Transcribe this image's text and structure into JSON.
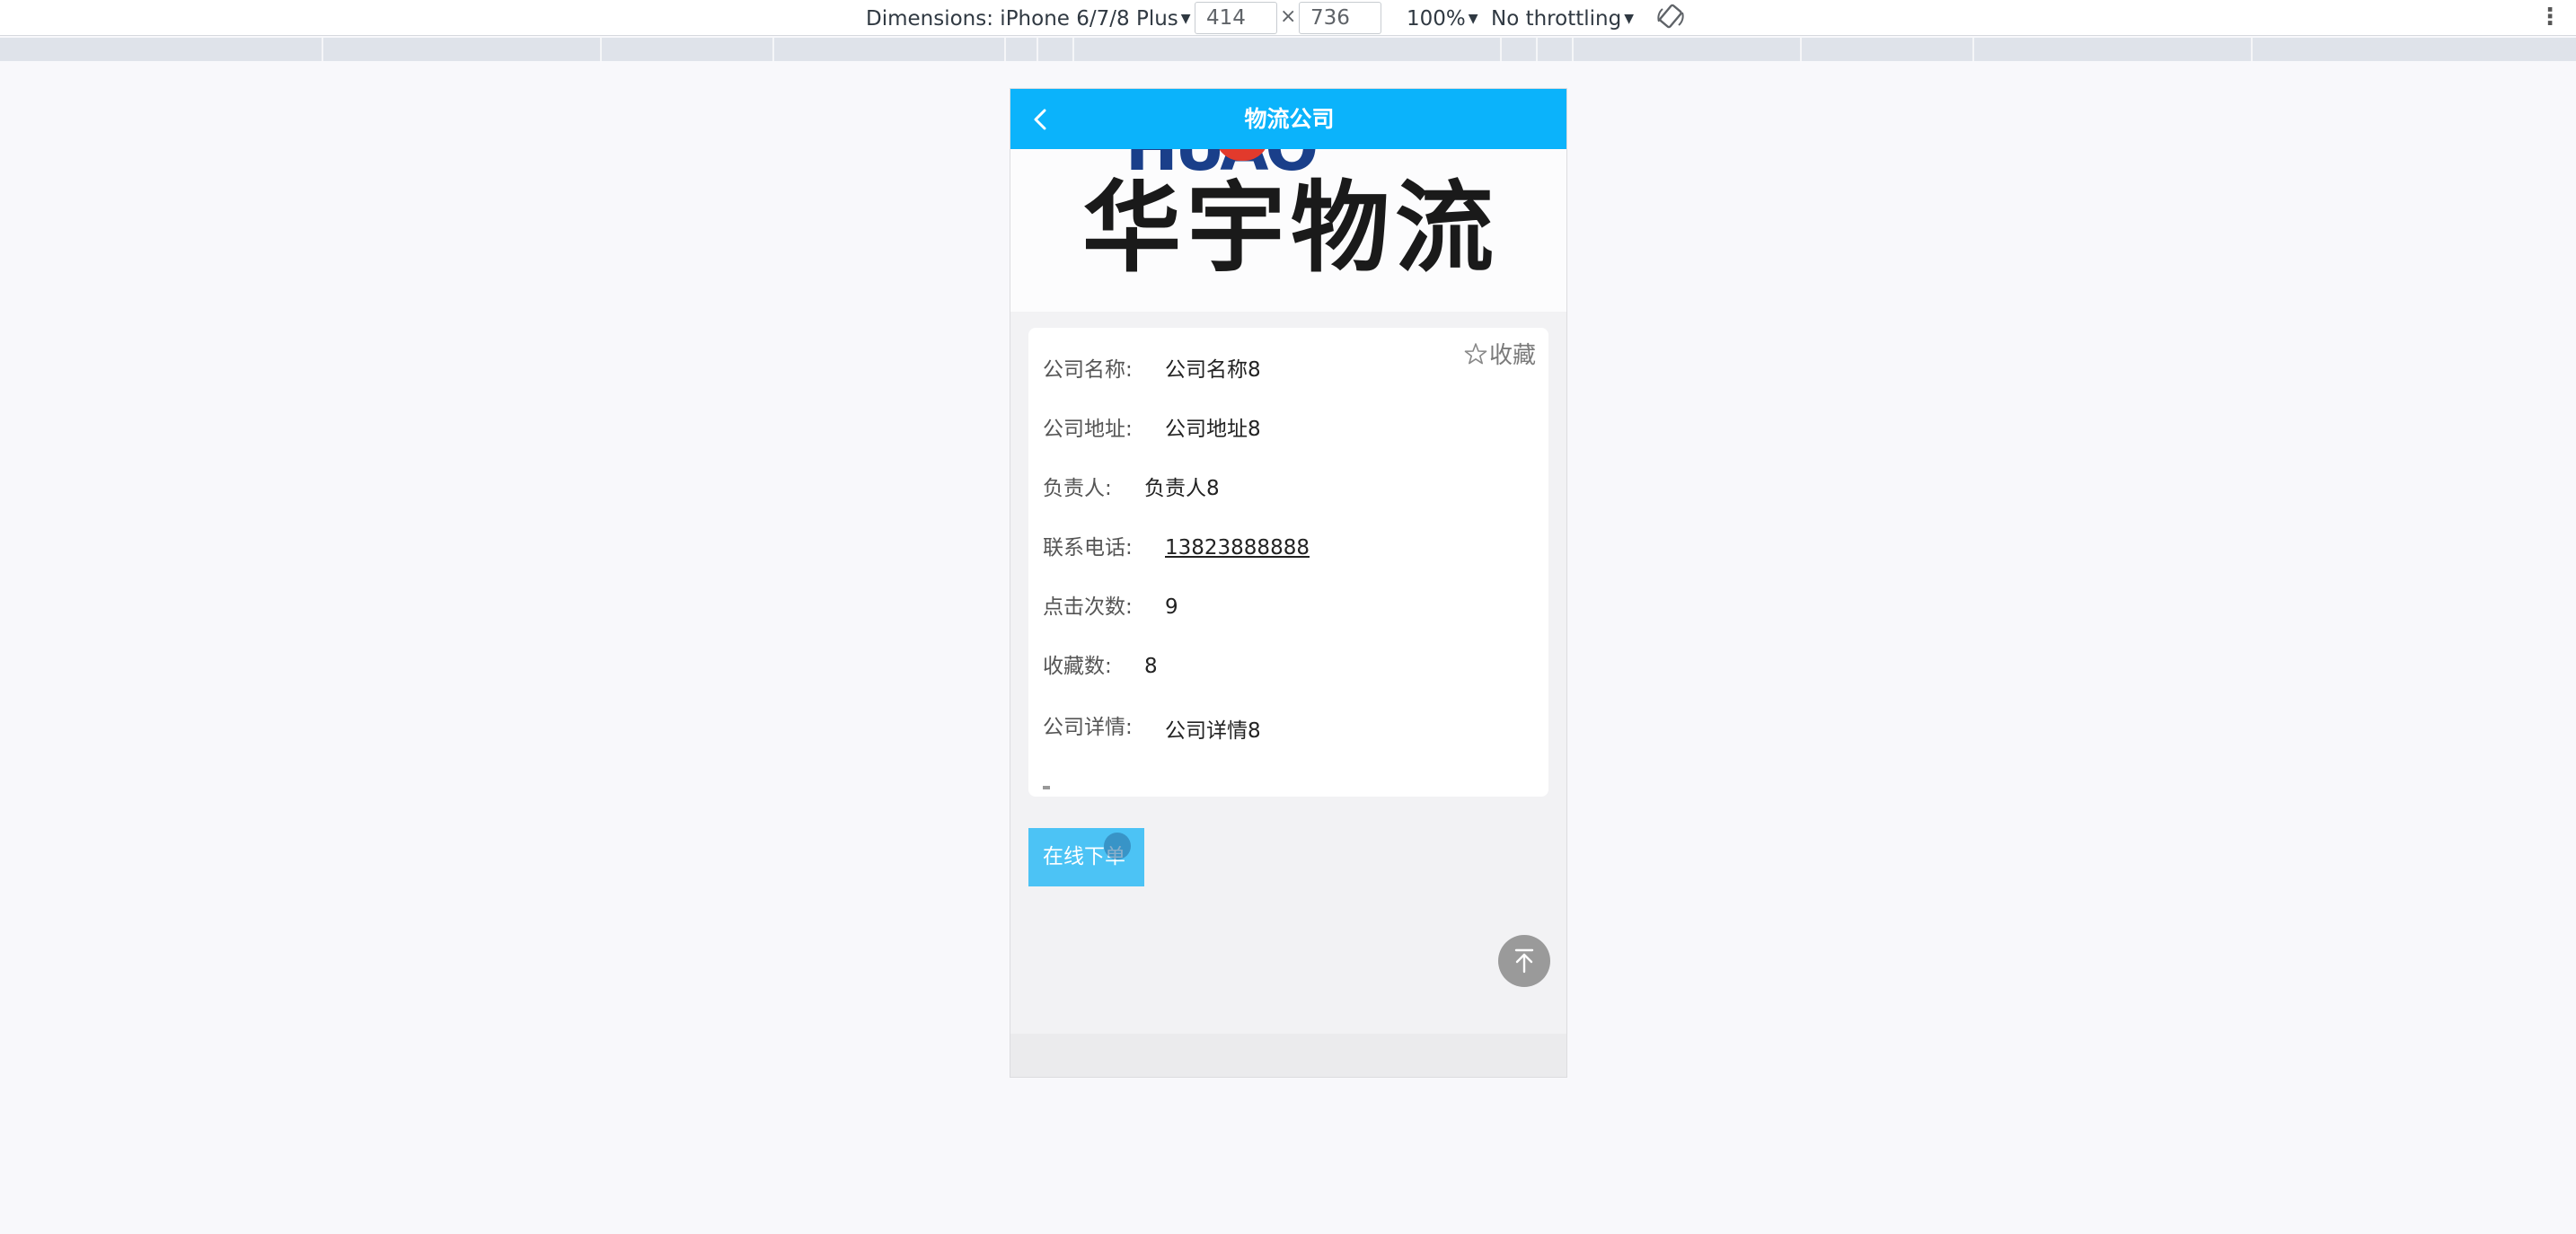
{
  "devtools": {
    "dimensions_label": "Dimensions: iPhone 6/7/8 Plus",
    "width_value": "414",
    "times": "×",
    "height_value": "736",
    "zoom": "100%",
    "throttling": "No throttling"
  },
  "banner": {
    "brand_partial": "HUAO",
    "title": "华宇物流"
  },
  "navbar": {
    "title": "物流公司"
  },
  "card": {
    "favorite_label": "收藏",
    "fields": [
      {
        "label": "公司名称:",
        "value": "公司名称8"
      },
      {
        "label": "公司地址:",
        "value": "公司地址8"
      },
      {
        "label": "负责人:",
        "value": "负责人8"
      },
      {
        "label": "联系电话:",
        "value": "13823888888"
      },
      {
        "label": "点击次数:",
        "value": "9"
      },
      {
        "label": "收藏数:",
        "value": "8"
      },
      {
        "label": "公司详情:",
        "value": "公司详情8"
      }
    ]
  },
  "actions": {
    "order_label": "在线下单"
  },
  "colors": {
    "navbar": "#0bb3fb",
    "order_button": "#4cc3f5",
    "back_to_top": "#9a9a9a"
  }
}
